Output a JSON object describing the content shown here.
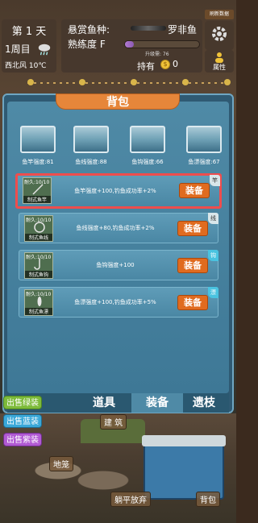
{
  "hud": {
    "day": "第 1 天",
    "week": "1周目",
    "wind": "西北风 10℃",
    "bounty_label": "悬赏鱼种:",
    "bounty_fish": "罗非鱼",
    "skill_label": "熟练度 F",
    "next_level": "升级需: 76",
    "hold_label": "持有",
    "coins": "0",
    "refresh": "刷新数据",
    "attr": "属性"
  },
  "panel": {
    "title": "背包",
    "slots": [
      {
        "label": "鱼竿强度:81"
      },
      {
        "label": "鱼线强度:88"
      },
      {
        "label": "鱼钩强度:66"
      },
      {
        "label": "鱼漂强度:67"
      }
    ],
    "items": [
      {
        "durability": "耐久:10/10",
        "name": "制式鱼竿",
        "desc": "鱼竿强度+100,钓鱼成功率+2%",
        "button": "装备",
        "corner": "竿"
      },
      {
        "durability": "耐久:10/10",
        "name": "制式鱼线",
        "desc": "鱼线强度+80,钓鱼成功率+2%",
        "button": "装备",
        "corner": "线"
      },
      {
        "durability": "耐久:10/10",
        "name": "制式鱼钩",
        "desc": "鱼钩强度+100",
        "button": "装备",
        "corner": "钩"
      },
      {
        "durability": "耐久:10/10",
        "name": "制式鱼漂",
        "desc": "鱼漂强度+100,钓鱼成功率+5%",
        "button": "装备",
        "corner": "漂"
      }
    ],
    "tabs": [
      "道具",
      "装备",
      "遗枝"
    ],
    "active_tab": 1
  },
  "sell": {
    "green": "出售绿装",
    "blue": "出售蓝装",
    "purple": "出售紫装"
  },
  "scene": {
    "build": "建 筑",
    "cage": "地笼",
    "lie": "躺平放弃",
    "bag": "背包"
  },
  "colors": {
    "selected_border": "#ef4d4d",
    "equip_button": "#e06b1f",
    "panel_bg": "#3e7896"
  }
}
